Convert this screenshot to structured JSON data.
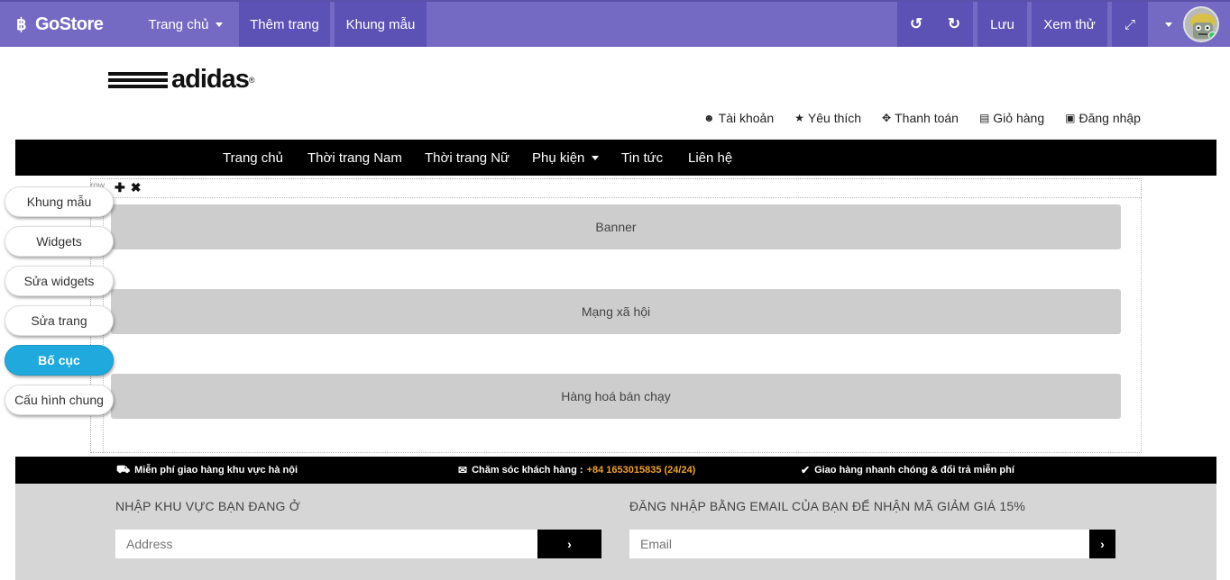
{
  "editor": {
    "brand": "GoStore",
    "brand_icon": "bitcoin-icon",
    "menu_home": "Trang chủ",
    "add_page": "Thêm trang",
    "templates": "Khung mẫu",
    "undo_icon": "↺",
    "redo_icon": "↻",
    "save": "Lưu",
    "preview": "Xem thử",
    "fullscreen_icon": "⤢"
  },
  "site": {
    "logo_text": "adidas",
    "logo_reg": "®",
    "top_links": [
      {
        "icon": "👤",
        "label": "Tài khoản"
      },
      {
        "icon": "★",
        "label": "Yêu thích"
      },
      {
        "icon": "✥",
        "label": "Thanh toán"
      },
      {
        "icon": "🛒",
        "label": "Giỏ hàng"
      },
      {
        "icon": "🔒",
        "label": "Đăng nhập"
      }
    ],
    "nav": [
      "Trang chủ",
      "Thời trang Nam",
      "Thời trang Nữ",
      "Phụ kiện",
      "Tin tức",
      "Liên hệ"
    ]
  },
  "canvas": {
    "row_label": "row",
    "add_icon": "✚",
    "remove_icon": "✖",
    "blocks": [
      "Banner",
      "Mạng xã hội",
      "Hàng hoá bán chạy"
    ]
  },
  "side_buttons": [
    "Khung mẫu",
    "Widgets",
    "Sửa widgets",
    "Sửa trang",
    "Bố cục",
    "Cấu hình chung"
  ],
  "side_active_index": 4,
  "info": {
    "shipping": "Miễn phí giao hàng khu vực hà nội",
    "support_label": "Chăm sóc khách hàng :",
    "support_phone": "+84 1653015835 (24/24)",
    "fast": "Giao hàng nhanh chóng & đổi trả miễn phí"
  },
  "footer": {
    "region_title": "NHẬP KHU VỰC BẠN ĐANG Ở",
    "region_placeholder": "Address",
    "email_title": "ĐĂNG NHẬP BẰNG EMAIL CỦA BẠN ĐỂ NHẬN MÃ GIẢM GIÁ 15%",
    "email_placeholder": "Email",
    "submit_icon": "›"
  },
  "colors": {
    "topbar": "#7469c3",
    "topbar_dark": "#5c51b4",
    "active_button": "#20a9dc",
    "phone": "#f0a030"
  }
}
